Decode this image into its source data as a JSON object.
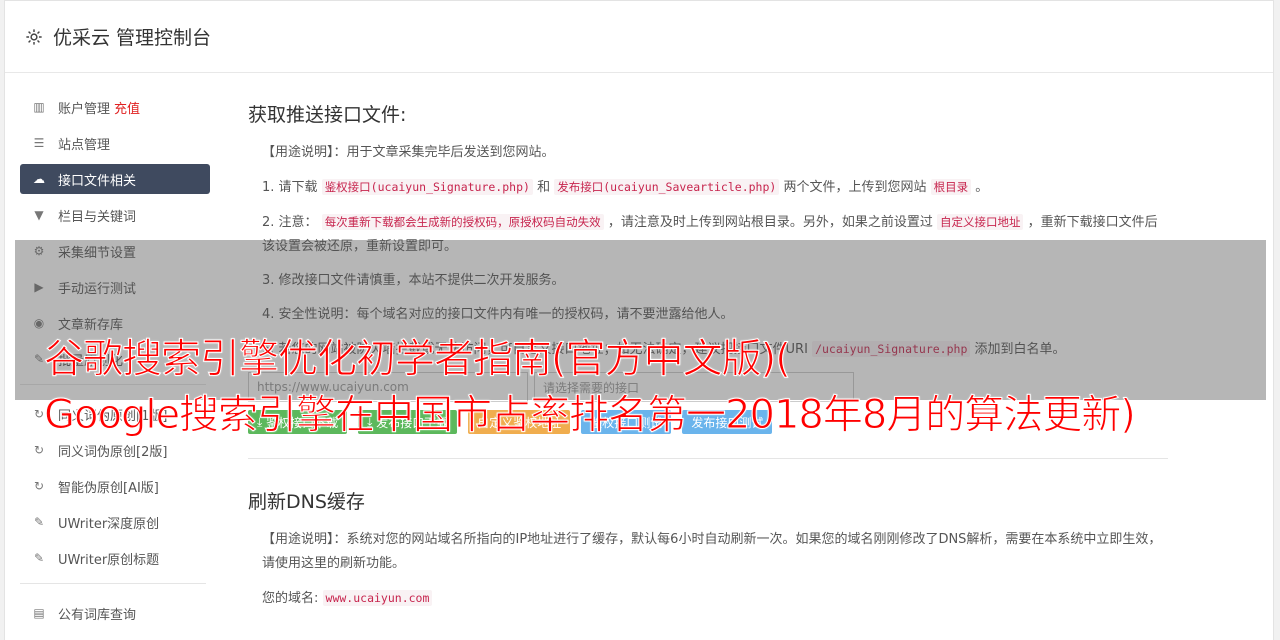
{
  "header": {
    "title": "优采云 管理控制台",
    "icon": "gear-icon"
  },
  "sidebar": {
    "items": [
      {
        "label": "账户管理",
        "extra": "充值",
        "icon": "bar-chart-icon"
      },
      {
        "label": "站点管理",
        "icon": "list-icon"
      },
      {
        "label": "接口文件相关",
        "icon": "cloud-upload-icon",
        "active": true
      },
      {
        "label": "栏目与关键词",
        "icon": "filter-icon"
      },
      {
        "label": "采集细节设置",
        "icon": "cogs-icon"
      },
      {
        "label": "手动运行测试",
        "icon": "play-icon"
      },
      {
        "label": "文章新存库",
        "icon": "database-icon"
      },
      {
        "label": "批量原创化",
        "icon": "edit-icon"
      },
      {
        "label": "同义词伪原创[1版]",
        "icon": "refresh-icon"
      },
      {
        "label": "同义词伪原创[2版]",
        "icon": "refresh-icon"
      },
      {
        "label": "智能伪原创[AI版]",
        "icon": "refresh-icon"
      },
      {
        "label": "UWriter深度原创",
        "icon": "edit-icon"
      },
      {
        "label": "UWriter原创标题",
        "icon": "edit-icon"
      },
      {
        "label": "公有词库查询",
        "icon": "book-icon"
      }
    ]
  },
  "section1": {
    "title": "获取推送接口文件:",
    "usage": "【用途说明】：用于文章采集完毕后发送到您网站。",
    "step1_prefix": "1. 请下载",
    "step1_code1": "鉴权接口(ucaiyun_Signature.php)",
    "step1_and": "和",
    "step1_code2": "发布接口(ucaiyun_Savearticle.php)",
    "step1_mid": "两个文件，上传到您网站",
    "step1_code3": "根目录",
    "step1_end": "。",
    "step2_prefix": "2. 注意：",
    "step2_code1": "每次重新下载都会生成新的授权码，原授权码自动失效",
    "step2_mid": "，请注意及时上传到网站根目录。另外，如果之前设置过",
    "step2_code2": "自定义接口地址",
    "step2_end": "，重新下载接口文件后该设置会被还原，重新设置即可。",
    "step3": "3. 修改接口文件请慎重，本站不提供二次开发服务。",
    "step4": "4. 安全性说明：每个域名对应的接口文件内有唯一的授权码，请不要泄露给他人。",
    "step5_prefix": "5. 若您的网站被防火墙拦截或无法访问，可自定义接口地址；如无法确定，建议把接口文件URI",
    "step5_code": "/ucaiyun_Signature.php",
    "step5_end": "添加到白名单。",
    "input_placeholder": "https://www.ucaiyun.com",
    "select_placeholder": "请选择需要的接口",
    "buttons": [
      {
        "label": "鉴权接口下载",
        "icon": "download-icon"
      },
      {
        "label": "发布接口下载",
        "icon": "download-icon"
      },
      {
        "label": "自定义鉴权地址"
      },
      {
        "label": "鉴权接口测试"
      },
      {
        "label": "发布接口测试"
      }
    ]
  },
  "section2": {
    "title": "刷新DNS缓存",
    "usage": "【用途说明】：系统对您的网站域名所指向的IP地址进行了缓存，默认每6小时自动刷新一次。如果您的域名刚刚修改了DNS解析，需要在本系统中立即生效，请使用这里的刷新功能。",
    "domain_label": "您的域名:",
    "domain_value": "www.ucaiyun.com"
  },
  "overlay": {
    "line1": "谷歌搜索引擎优化初学者指南(官方中文版)(",
    "line2": "Google搜索引擎在中国市占率排名第一2018年8月的算法更新)"
  },
  "colors": {
    "active_bg": "#3f4a5f",
    "overlay_text": "#ff0000",
    "btn_green": "#5cb85c",
    "btn_orange": "#f0ad4e",
    "btn_blue": "#6ab4ec"
  }
}
